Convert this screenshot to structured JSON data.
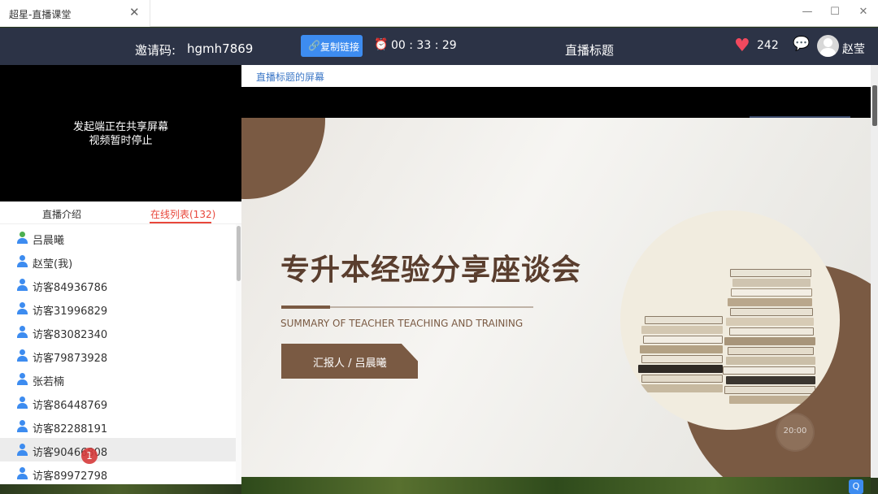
{
  "window": {
    "tab_title": "超星-直播课堂",
    "close_glyph": "✕",
    "minimize_glyph": "—",
    "maximize_glyph": "☐",
    "window_close_glyph": "✕"
  },
  "header": {
    "invite_label": "邀请码:",
    "invite_code": "hgmh7869",
    "copy_button_label": "复制链接",
    "timer": "00 : 33 : 29",
    "live_title": "直播标题",
    "like_count": "242",
    "user_name": "赵莹",
    "icons": {
      "copy": "link-icon",
      "clock": "alarm-clock-icon",
      "heart": "heart-icon",
      "chat": "chat-bubble-icon",
      "avatar": "user-avatar-icon"
    },
    "colors": {
      "bar": "#2c3346",
      "copy_button": "#3d8cf0",
      "heart": "#f2495e"
    }
  },
  "video": {
    "line1": "发起端正在共享屏幕",
    "line2": "视频暂时停止"
  },
  "panel_tabs": {
    "intro": "直播介绍",
    "online": "在线列表(132)",
    "active_color": "#e8473b"
  },
  "online_list": [
    {
      "name": "吕晨曦",
      "role": "host"
    },
    {
      "name": "赵莹(我)",
      "role": "self"
    },
    {
      "name": "访客84936786",
      "role": "guest"
    },
    {
      "name": "访客31996829",
      "role": "guest"
    },
    {
      "name": "访客83082340",
      "role": "guest"
    },
    {
      "name": "访客79873928",
      "role": "guest"
    },
    {
      "name": "张若楠",
      "role": "guest"
    },
    {
      "name": "访客86448769",
      "role": "guest"
    },
    {
      "name": "访客82288191",
      "role": "guest"
    },
    {
      "name": "访客90466808",
      "role": "guest"
    },
    {
      "name": "访客89972798",
      "role": "guest"
    }
  ],
  "marker_label": "1",
  "screen": {
    "subtitle": "直播标题的屏幕"
  },
  "slide": {
    "title": "专升本经验分享座谈会",
    "subtitle": "SUMMARY OF TEACHER TEACHING AND TRAINING",
    "reporter": "汇报人 / 吕晨曦",
    "timer_text": "20:00",
    "accent_color": "#7a5a43"
  },
  "tray_label": "Q"
}
